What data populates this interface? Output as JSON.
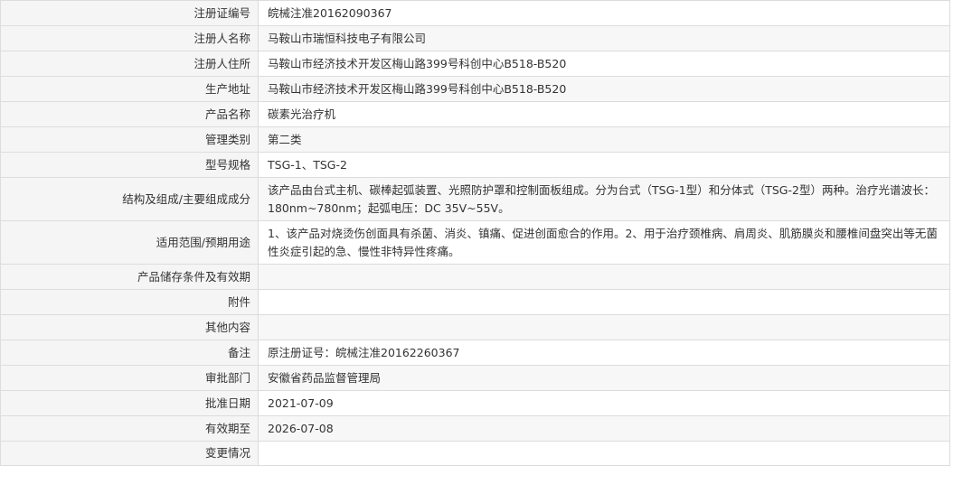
{
  "rows": [
    {
      "label": "注册证编号",
      "value": "皖械注准20162090367"
    },
    {
      "label": "注册人名称",
      "value": "马鞍山市瑞恒科技电子有限公司"
    },
    {
      "label": "注册人住所",
      "value": "马鞍山市经济技术开发区梅山路399号科创中心B518-B520"
    },
    {
      "label": "生产地址",
      "value": "马鞍山市经济技术开发区梅山路399号科创中心B518-B520"
    },
    {
      "label": "产品名称",
      "value": "碳素光治疗机"
    },
    {
      "label": "管理类别",
      "value": "第二类"
    },
    {
      "label": "型号规格",
      "value": "TSG-1、TSG-2"
    },
    {
      "label": "结构及组成/主要组成成分",
      "value": "该产品由台式主机、碳棒起弧装置、光照防护罩和控制面板组成。分为台式（TSG-1型）和分体式（TSG-2型）两种。治疗光谱波长：180nm~780nm；起弧电压：DC 35V~55V。"
    },
    {
      "label": "适用范围/预期用途",
      "value": "1、该产品对烧烫伤创面具有杀菌、消炎、镇痛、促进创面愈合的作用。2、用于治疗颈椎病、肩周炎、肌筋膜炎和腰椎间盘突出等无菌性炎症引起的急、慢性非特异性疼痛。"
    },
    {
      "label": "产品储存条件及有效期",
      "value": ""
    },
    {
      "label": "附件",
      "value": ""
    },
    {
      "label": "其他内容",
      "value": ""
    },
    {
      "label": "备注",
      "value": "原注册证号：皖械注准20162260367"
    },
    {
      "label": "审批部门",
      "value": "安徽省药品监督管理局"
    },
    {
      "label": "批准日期",
      "value": "2021-07-09"
    },
    {
      "label": "有效期至",
      "value": "2026-07-08"
    },
    {
      "label": "变更情况",
      "value": ""
    }
  ]
}
